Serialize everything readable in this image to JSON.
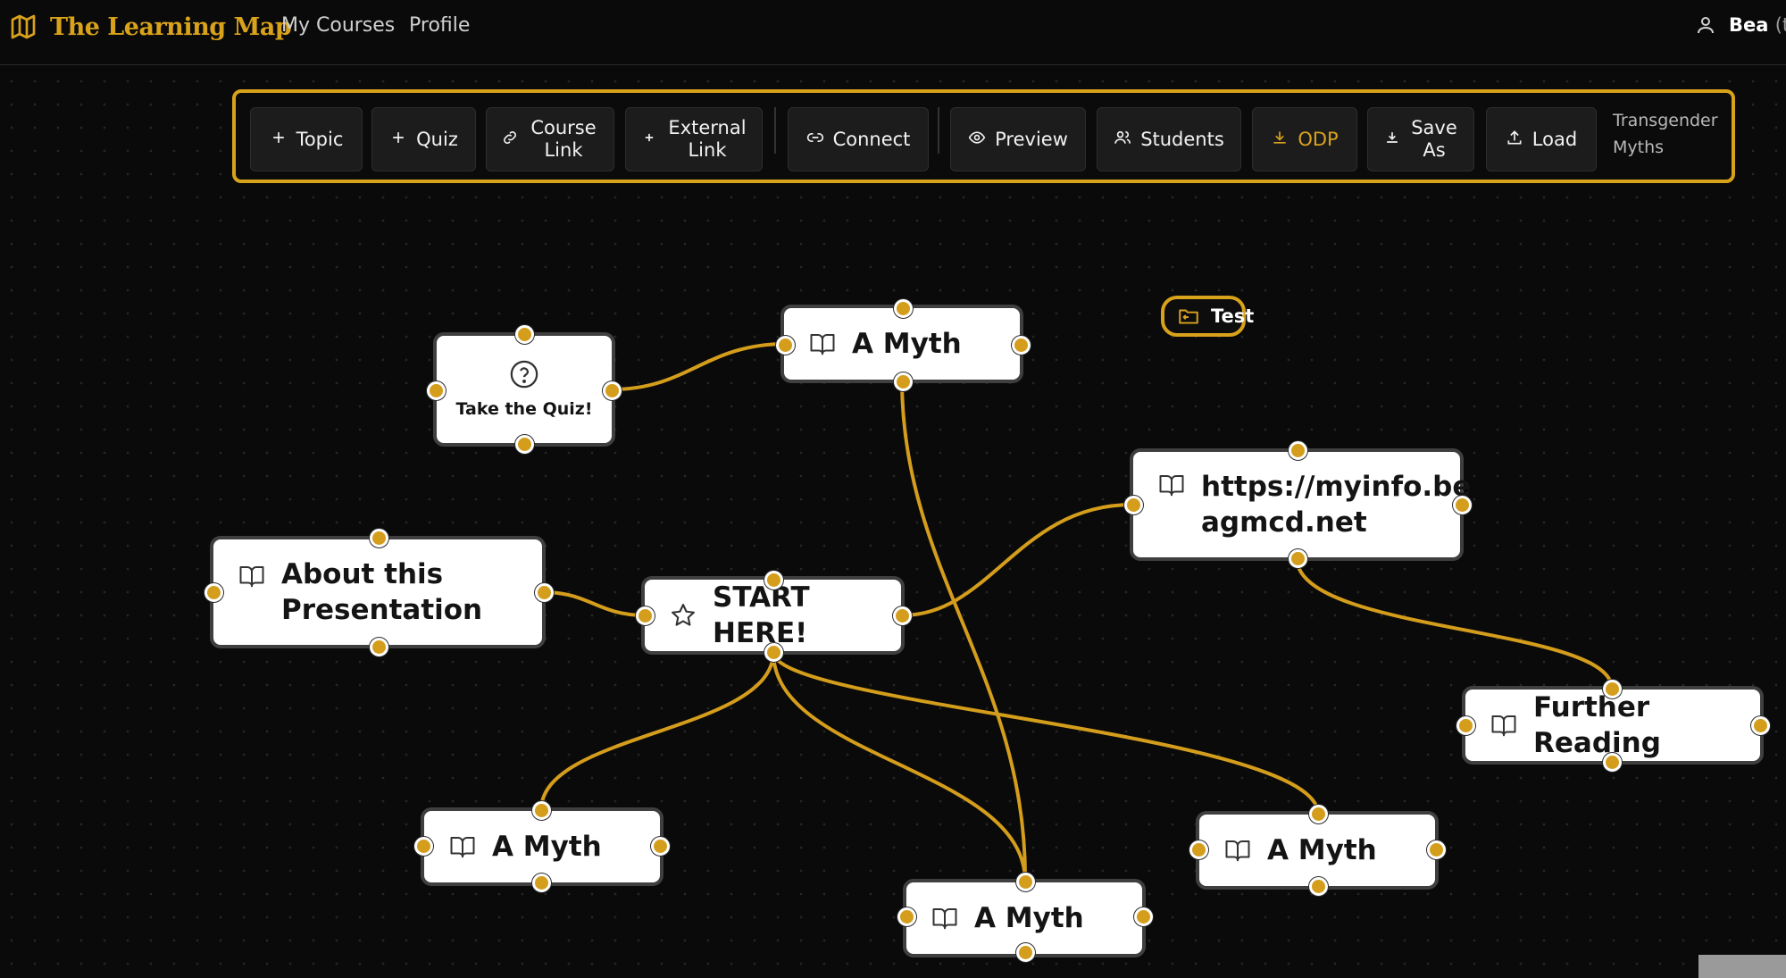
{
  "nav": {
    "brand": "The Learning Map",
    "brand_icon": "map-icon",
    "links": [
      "My Courses",
      "Profile"
    ],
    "user_icon": "user-icon",
    "user_name": "Bea",
    "user_extra": "(te"
  },
  "toolbar": {
    "buttons": [
      {
        "label": "Topic",
        "icon": "plus-icon"
      },
      {
        "label": "Quiz",
        "icon": "plus-icon"
      },
      {
        "label": "Course Link",
        "icon": "link-icon"
      },
      {
        "label": "External Link",
        "icon": "plus-icon"
      },
      {
        "label": "Connect",
        "icon": "chain-link-icon"
      },
      {
        "label": "Preview",
        "icon": "eye-icon"
      },
      {
        "label": "Students",
        "icon": "users-icon"
      },
      {
        "label": "ODP",
        "icon": "download-icon"
      },
      {
        "label": "Save As",
        "icon": "download-icon"
      },
      {
        "label": "Load",
        "icon": "upload-icon"
      }
    ],
    "course_title": "Transgender Myths"
  },
  "nodes": {
    "quiz": {
      "label": "Take the Quiz!",
      "icon": "question-circle-icon"
    },
    "myth_top": {
      "label": "A Myth",
      "icon": "book-open-icon"
    },
    "folder_test": {
      "label": "Test",
      "icon": "folder-icon"
    },
    "url": {
      "label": "https://myinfo.beagmcd.net",
      "label_line1": "https://myinfo.be",
      "label_line2": "agmcd.net",
      "icon": "book-open-icon"
    },
    "about": {
      "label": "About this Presentation",
      "icon": "book-open-icon"
    },
    "start": {
      "label": "START HERE!",
      "icon": "star-icon"
    },
    "further": {
      "label": "Further Reading",
      "icon": "book-open-icon"
    },
    "myth_left": {
      "label": "A Myth",
      "icon": "book-open-icon"
    },
    "myth_right": {
      "label": "A Myth",
      "icon": "book-open-icon"
    },
    "myth_bottom": {
      "label": "A Myth",
      "icon": "book-open-icon"
    }
  },
  "colors": {
    "accent": "#d9a21b",
    "edge": "#d49d1c",
    "background": "#0a0a0a",
    "node_fill": "#ffffff",
    "node_border": "#3f3f3f"
  }
}
